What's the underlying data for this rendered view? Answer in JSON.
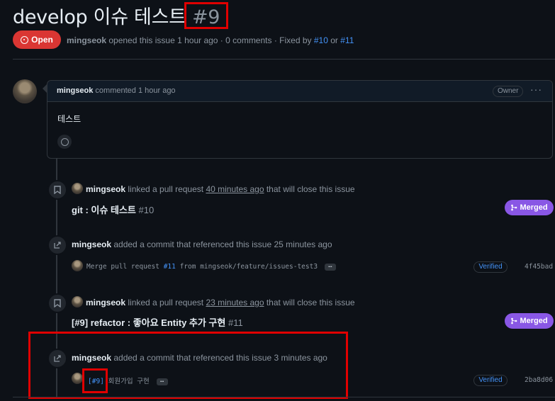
{
  "issue": {
    "title": "develop 이슈 테스트",
    "number": "#9",
    "state": "Open",
    "author": "mingseok",
    "meta_text": "opened this issue 1 hour ago · 0 comments · Fixed by",
    "fixed_by_1": "#10",
    "or_text": "or",
    "fixed_by_2": "#11"
  },
  "comment": {
    "author": "mingseok",
    "action": "commented 1 hour ago",
    "role_badge": "Owner",
    "body": "테스트"
  },
  "events": [
    {
      "type": "linked-pr",
      "icon": "bookmark-icon",
      "author": "mingseok",
      "text_before": "linked a pull request",
      "time": "40 minutes ago",
      "text_after": "that will close this issue",
      "pr_title": "git : 이슈 테스트",
      "pr_number": "#10",
      "status": "Merged"
    },
    {
      "type": "commit-ref",
      "icon": "cross-reference-icon",
      "author": "mingseok",
      "text": "added a commit that referenced this issue 25 minutes ago",
      "commit_prefix": "Merge pull request",
      "commit_ref": "#11",
      "commit_suffix": "from mingseok/feature/issues-test3",
      "verified": "Verified",
      "sha": "4f45bad"
    },
    {
      "type": "linked-pr",
      "icon": "bookmark-icon",
      "author": "mingseok",
      "text_before": "linked a pull request",
      "time": "23 minutes ago",
      "text_after": "that will close this issue",
      "pr_title": "[#9] refactor : 좋아요 Entity 추가 구현",
      "pr_number": "#11",
      "status": "Merged"
    },
    {
      "type": "commit-ref",
      "icon": "cross-reference-icon",
      "author": "mingseok",
      "text": "added a commit that referenced this issue 3 minutes ago",
      "commit_ref": "[#9]",
      "commit_suffix": "회원가입 구현",
      "verified": "Verified",
      "sha": "2ba8d06"
    }
  ],
  "colors": {
    "background": "#0d1117",
    "open": "#da3633",
    "merged": "#8957e5",
    "link": "#4493f8",
    "highlight": "#e00000"
  }
}
